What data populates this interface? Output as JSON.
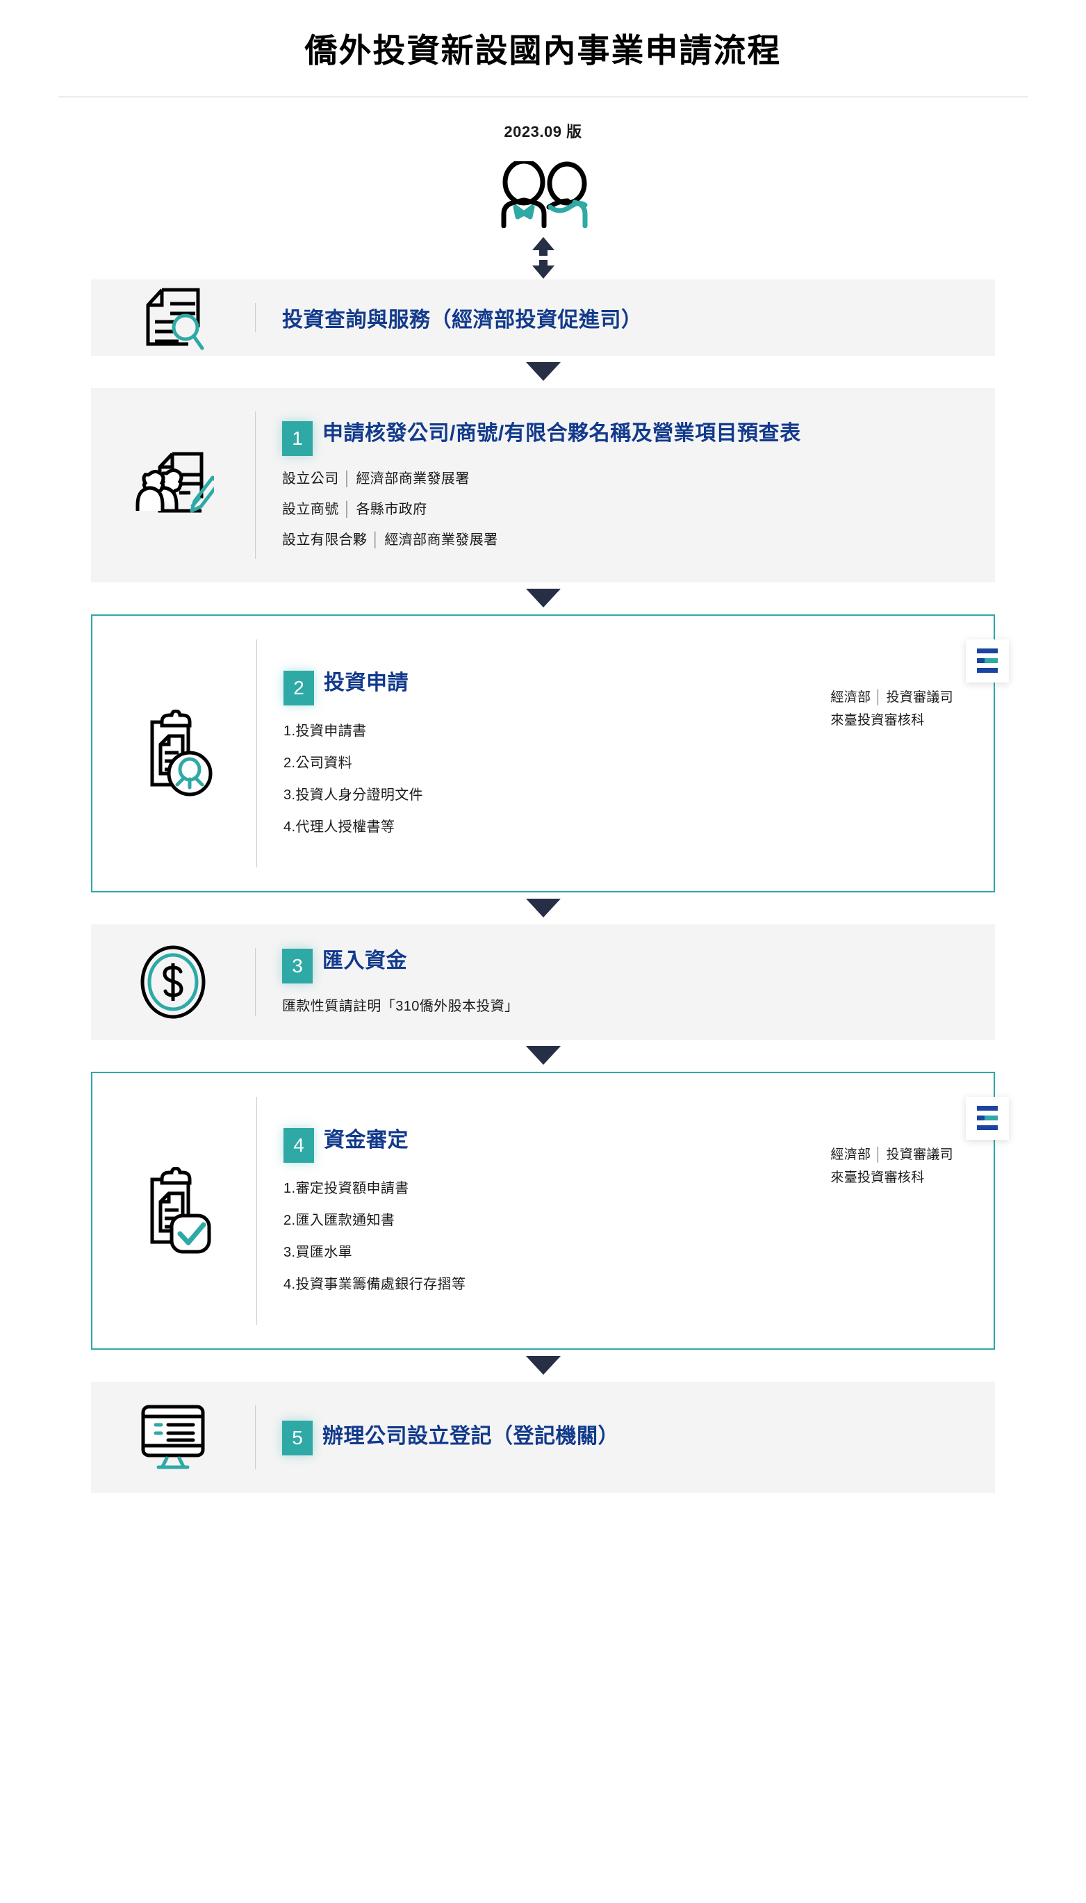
{
  "document": {
    "title": "僑外投資新設國內事業申請流程",
    "version": "2023.09 版"
  },
  "colors": {
    "teal": "#2EA9A6",
    "heading_blue": "#123A8C",
    "badge_blue": "#1B44A0",
    "arrow_navy": "#262F45",
    "panel_gray": "#F4F4F4"
  },
  "intro": {
    "people_icon": "two-people-icon",
    "connector_icon": "up-down-arrow-icon"
  },
  "service_row": {
    "icon": "document-search-icon",
    "title": "投資查詢與服務（經濟部投資促進司）"
  },
  "steps": [
    {
      "number": "1",
      "icon": "people-document-pencil-icon",
      "title": "申請核發公司/商號/有限合夥名稱及營業項目預查表",
      "style": "gray",
      "details": [
        {
          "label": "設立公司",
          "value": "經濟部商業發展署"
        },
        {
          "label": "設立商號",
          "value": "各縣市政府"
        },
        {
          "label": "設立有限合夥",
          "value": "經濟部商業發展署"
        }
      ]
    },
    {
      "number": "2",
      "icon": "clipboard-person-badge-icon",
      "title": "投資申請",
      "style": "card",
      "documents": [
        "1.投資申請書",
        "2.公司資料",
        "3.投資人身分證明文件",
        "4.代理人授權書等"
      ],
      "authority": {
        "ministry": "經濟部",
        "department": "投資審議司",
        "section": "來臺投資審核科",
        "icon": "authority-bars-icon"
      }
    },
    {
      "number": "3",
      "icon": "dollar-circle-icon",
      "style": "gray",
      "title": "匯入資金",
      "note": "匯款性質請註明「310僑外股本投資」"
    },
    {
      "number": "4",
      "icon": "clipboard-check-icon",
      "title": "資金審定",
      "style": "card",
      "documents": [
        "1.審定投資額申請書",
        "2.匯入匯款通知書",
        "3.買匯水單",
        "4.投資事業籌備處銀行存摺等"
      ],
      "authority": {
        "ministry": "經濟部",
        "department": "投資審議司",
        "section": "來臺投資審核科",
        "icon": "authority-bars-icon"
      }
    },
    {
      "number": "5",
      "icon": "monitor-list-icon",
      "style": "gray",
      "title": "辦理公司設立登記（登記機關）"
    }
  ]
}
